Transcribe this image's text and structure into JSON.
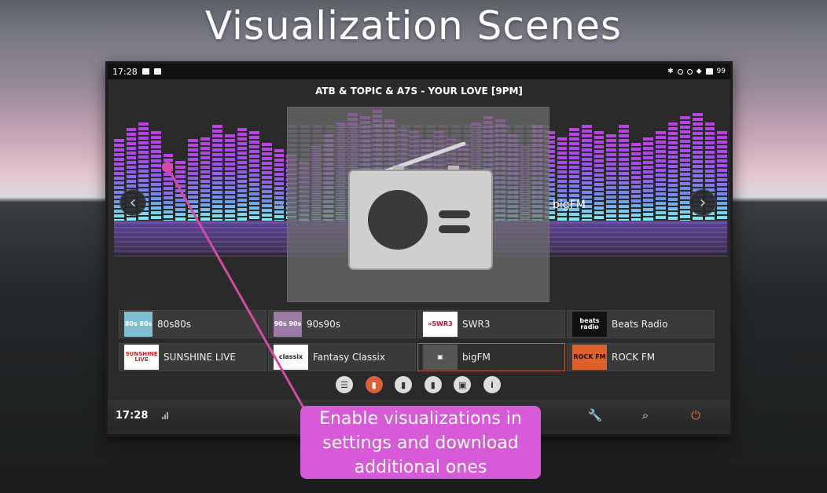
{
  "promo": {
    "title": "Visualization Scenes",
    "callout": {
      "line1": "Enable visualizations in",
      "line2": "settings and download",
      "line3": "additional ones"
    }
  },
  "status_bar": {
    "time": "17:28",
    "battery": "99"
  },
  "now_playing": "ATB & TOPIC & A7S - YOUR LOVE [9PM]",
  "carousel": {
    "prev_station_label": "09",
    "next_station_label": "bigFM",
    "current_station_art": "radio-icon"
  },
  "stations": [
    {
      "name": "80s80s",
      "logo_text": "80s 80s",
      "active": false
    },
    {
      "name": "90s90s",
      "logo_text": "90s 90s",
      "active": false
    },
    {
      "name": "SWR3",
      "logo_text": "»SWR3",
      "active": false
    },
    {
      "name": "Beats Radio",
      "logo_text": "beats radio",
      "active": false
    },
    {
      "name": "SUNSHINE LIVE",
      "logo_text": "SUNSHINE LIVE",
      "active": false
    },
    {
      "name": "Fantasy Classix",
      "logo_text": "classix",
      "active": false
    },
    {
      "name": "bigFM",
      "logo_text": "▣",
      "active": true
    },
    {
      "name": "ROCK FM",
      "logo_text": "ROCK FM",
      "active": false
    }
  ],
  "tabs": [
    "list-icon",
    "bookmark-icon",
    "bookmark-icon",
    "bookmark-icon",
    "image-icon",
    "info-icon"
  ],
  "tab_glyphs": [
    "☰",
    "▮",
    "▮",
    "▮",
    "▣",
    "i"
  ],
  "bottom_bar": {
    "time": "17:28",
    "settings_icon": "wrench-icon",
    "search_icon": "search-icon",
    "power_icon": "power-icon"
  },
  "colors": {
    "accent": "#d9603a",
    "callout": "#d95ad8",
    "eq_top": "#c040e8",
    "eq_bottom": "#80f0f0"
  }
}
